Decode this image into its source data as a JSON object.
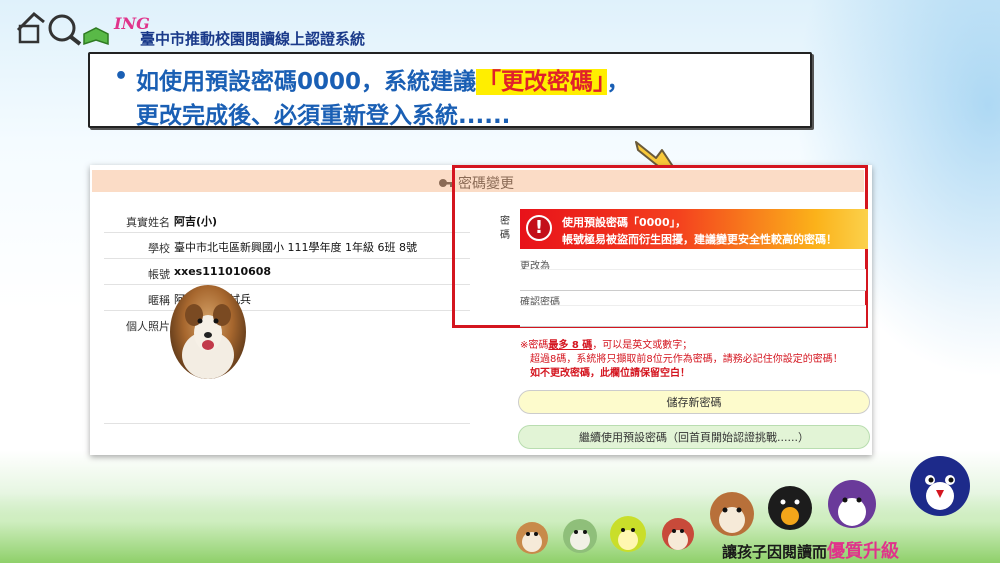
{
  "header": {
    "logo_text": "ING",
    "system_title": "臺中市推動校園閱讀線上認證系統"
  },
  "banner": {
    "bullet": "•",
    "line1_before": "如使用預設密碼0000，系統建議",
    "line1_highlight": "「更改密碼」",
    "line1_after": "，",
    "line2": "更改完成後、必須重新登入系統......"
  },
  "panel": {
    "title": "密碼變更",
    "profile": {
      "name_label": "真實姓名",
      "name_value": "阿吉(小)",
      "school_label": "學校",
      "school_value": "臺中市北屯區新興國小 111學年度 1年級 6班 8號",
      "account_label": "帳號",
      "account_value": "xxes111010608",
      "nickname_label": "暱稱",
      "nickname_value": "阿吉小一測試兵",
      "photo_label": "個人照片"
    },
    "password": {
      "label": "密碼",
      "warning_line1": "使用預設密碼「0000」，",
      "warning_line2": "帳號極易被盜而衍生困擾，建議變更安全性較高的密碼！",
      "change_label": "更改為",
      "confirm_label": "確認密碼",
      "note_line1_a": "※密碼",
      "note_line1_b": "最多 8 碼",
      "note_line1_c": "，可以是英文或數字；",
      "note_line2": "超過8碼，系統將只擷取前8位元作為密碼，請務必記住你設定的密碼！",
      "note_line3": "如不更改密碼，此欄位請保留空白！"
    },
    "buttons": {
      "save": "儲存新密碼",
      "keep": "繼續使用預設密碼（回首頁開始認證挑戰......）"
    }
  },
  "footer": {
    "slogan_a": "讓孩子因閱讀而",
    "slogan_b": "優質升級"
  },
  "colors": {
    "accent_blue": "#1a5fb4",
    "highlight": "#ffee00",
    "alert_red": "#d4151f"
  }
}
